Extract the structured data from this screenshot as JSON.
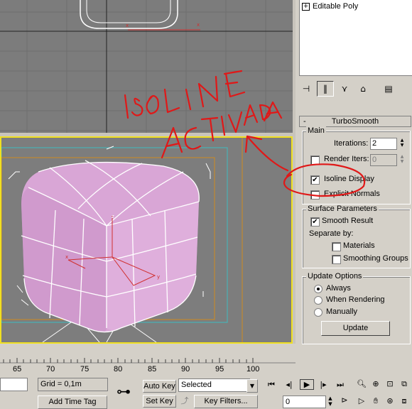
{
  "command_panel": {
    "modifier_stack": [
      "Editable Poly"
    ],
    "rollout_title": "TurboSmooth",
    "main": {
      "title": "Main",
      "iterations_label": "Iterations:",
      "iterations_value": "2",
      "render_iters_label": "Render Iters:",
      "render_iters_value": "0",
      "render_iters_checked": false,
      "isoline_label": "Isoline Display",
      "isoline_checked": true,
      "explicit_normals_label": "Explicit Normals",
      "explicit_normals_checked": false
    },
    "surface": {
      "title": "Surface Parameters",
      "smooth_result_label": "Smooth Result",
      "smooth_result_checked": true,
      "separate_by_label": "Separate by:",
      "materials_label": "Materials",
      "smoothing_groups_label": "Smoothing Groups"
    },
    "update": {
      "title": "Update Options",
      "always_label": "Always",
      "when_rendering_label": "When Rendering",
      "manually_label": "Manually",
      "selected": "Always",
      "update_button": "Update"
    }
  },
  "timeline": {
    "ticks": [
      "65",
      "70",
      "75",
      "80",
      "85",
      "90",
      "95",
      "100"
    ]
  },
  "status_bar": {
    "grid": "Grid = 0,1m",
    "add_time_tag": "Add Time Tag",
    "auto_key": "Auto Key",
    "set_key": "Set Key",
    "key_mode": "Selected",
    "key_filters": "Key Filters...",
    "frame": "0"
  },
  "annotation": {
    "line1": "ISOLINE",
    "line2": "ACTIVADA",
    "color": "#e01818"
  },
  "colors": {
    "viewport_bg": "#7d7d7d",
    "active_border": "#f0e020",
    "object": "#d9a6d6"
  }
}
